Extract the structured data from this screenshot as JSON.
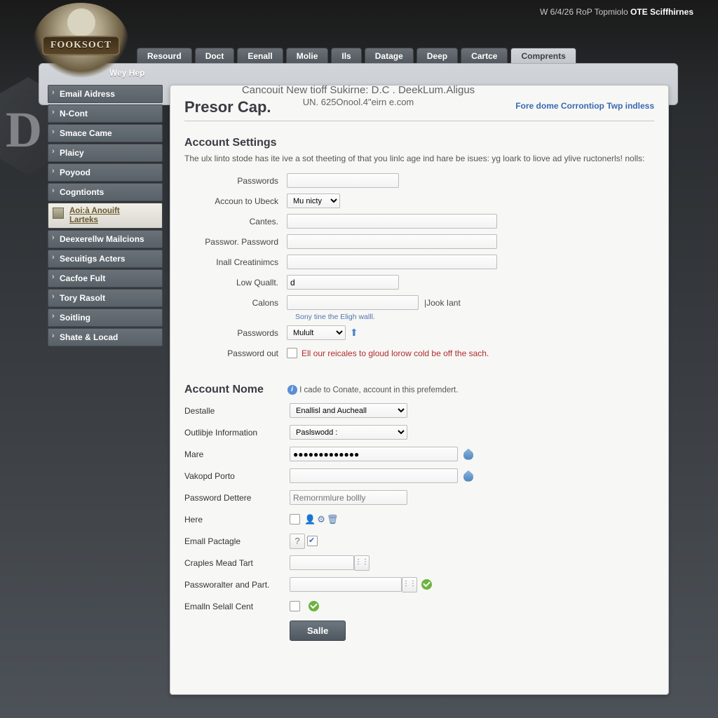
{
  "header": {
    "date": "W 6/4/26 RoP Topmiolo",
    "tail": "OTE Sciffhirnes"
  },
  "logo": "FOOKSOCT",
  "bg_letter": "D",
  "nav": {
    "items": [
      {
        "label": "Resourd"
      },
      {
        "label": "Doct"
      },
      {
        "label": "Eenall"
      },
      {
        "label": "Molie"
      },
      {
        "label": "Ils"
      },
      {
        "label": "Datage"
      },
      {
        "label": "Deep"
      },
      {
        "label": "Cartce"
      },
      {
        "label": "Comprents"
      }
    ]
  },
  "crumb": "Wey Hep",
  "sidebar": {
    "items": [
      {
        "label": "Email Aidress"
      },
      {
        "label": "N-Cont"
      },
      {
        "label": "Smace Came"
      },
      {
        "label": "Plaicy"
      },
      {
        "label": "Poyood"
      },
      {
        "label": "Cogntionts"
      },
      {
        "label_a": "Aoi:à Anouift",
        "label_b": "Larteks",
        "active": true
      },
      {
        "label": "Deexerellw Mailcions"
      },
      {
        "label": "Secuitigs Acters"
      },
      {
        "label": "Cacfoe Fult"
      },
      {
        "label": "Tory Rasolt"
      },
      {
        "label": "Soitling"
      },
      {
        "label": "Shate & Locad"
      }
    ]
  },
  "content": {
    "corner_link": "Fore dome Corrontiop Twp indless",
    "h1": "Presor Cap.",
    "h2a": "Account Settings",
    "intro": "The ulx linto stode has ite ive a sot theeting of that you linlc age ind hare be isues: yg loark to liove ad ylive ructonerls! nolls:",
    "f": {
      "passwords": "Passwords",
      "account_ubeck": "Accoun to Ubeck",
      "account_ubeck_val": "Mu nicty",
      "cantes": "Cantes.",
      "pass_pass": "Passwor. Password",
      "inal_cred": "Inall Creatinimcs",
      "low_qual": "Low Quallt.",
      "low_qual_val": "d",
      "calons": "Calons",
      "calons_side": "|Jook  Iant",
      "hint": "Sony tine the Eligh walll.",
      "passwords2": "Passwords",
      "passwords2_val": "Mulult",
      "password_out": "Password out",
      "warn": "Ell our reicales to gloud lorow cold be off the sach."
    },
    "h2b": "Account Nome",
    "note2": "I cade to Conate, account in this prefemdert.",
    "g": {
      "destalle": "Destalle",
      "destalle_val": "Enallisl and Aucheall",
      "outible": "Outlibje Information",
      "outible_val": "Paslswodd :",
      "mare": "Mare",
      "mare_val": "●●●●●●●●●●●●●",
      "vakopd": "Vakopd Porto",
      "pass_det": "Password Dettere",
      "pass_det_ph": "Remornmlure bollly",
      "here": "Here",
      "email_pac": "Emall Pactagle",
      "qmark": "?",
      "craples": "Craples Mead Tart",
      "passafter": "Passworalter and Part.",
      "email_sel": "Emalln Selall Cent",
      "save": "Salle"
    }
  },
  "footer": {
    "l1": "Cancouit New tioff Sukirne: D.C . DeekLum.Aligus",
    "l2": "UN. 625Onool.4\"eirn e.com"
  }
}
